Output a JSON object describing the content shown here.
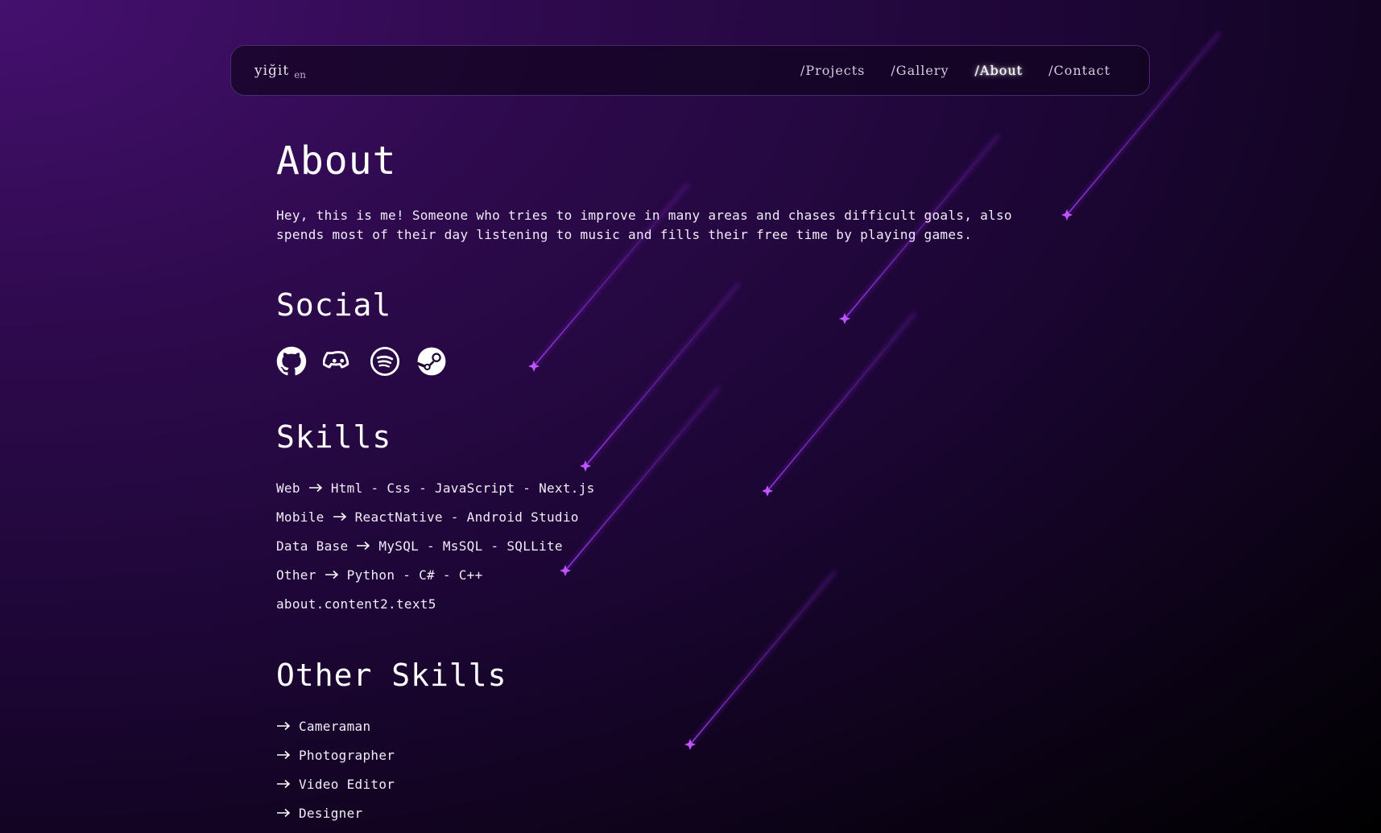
{
  "header": {
    "brand": "yiğit",
    "language": "en",
    "nav": [
      {
        "label": "/Projects",
        "active": false
      },
      {
        "label": "/Gallery",
        "active": false
      },
      {
        "label": "/About",
        "active": true
      },
      {
        "label": "/Contact",
        "active": false
      }
    ]
  },
  "about": {
    "title": "About",
    "intro": "Hey, this is me! Someone who tries to improve in many areas and chases difficult goals, also spends most of their day listening to music and fills their free time by playing games."
  },
  "social": {
    "title": "Social",
    "icons": [
      "github-icon",
      "discord-icon",
      "spotify-icon",
      "steam-icon"
    ]
  },
  "skills": {
    "title": "Skills",
    "items": [
      {
        "category": "Web",
        "detail": "Html - Css - JavaScript - Next.js"
      },
      {
        "category": "Mobile",
        "detail": "ReactNative - Android Studio"
      },
      {
        "category": "Data Base",
        "detail": "MySQL - MsSQL - SQLLite"
      },
      {
        "category": "Other",
        "detail": "Python - C# - C++"
      }
    ],
    "extra": "about.content2.text5"
  },
  "other_skills": {
    "title": "Other Skills",
    "items": [
      "Cameraman",
      "Photographer",
      "Video Editor",
      "Designer"
    ]
  },
  "colors": {
    "background_top": "#45106f",
    "background_bottom": "#000000",
    "meteor": "#b53cff",
    "text": "#ffffff"
  }
}
